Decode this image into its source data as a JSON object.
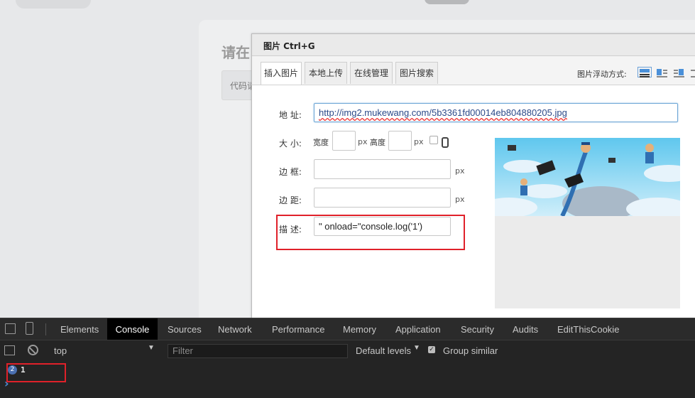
{
  "background": {
    "heading": "请在",
    "editor_text": "代码请"
  },
  "dialog": {
    "title": "图片 Ctrl+G",
    "tabs": [
      "插入图片",
      "本地上传",
      "在线管理",
      "图片搜索"
    ],
    "float_label": "图片浮动方式:",
    "float_icons": [
      "float-none-icon",
      "float-left-icon",
      "float-right-icon",
      "float-center-icon"
    ],
    "fields": {
      "address_label": "地 址:",
      "address_value": "http://img2.mukewang.com/5b3361fd00014eb804880205.jpg",
      "size_label": "大 小:",
      "width_label": "宽度",
      "height_label": "高度",
      "px_unit": "px",
      "border_label": "边 框:",
      "margin_label": "边 距:",
      "desc_label": "描 述:",
      "desc_value": "\" onload=\"console.log('1')"
    },
    "preview_image": "cloud-computing-illustration"
  },
  "devtools": {
    "tabs": [
      "Elements",
      "Console",
      "Sources",
      "Network",
      "Performance",
      "Memory",
      "Application",
      "Security",
      "Audits",
      "EditThisCookie"
    ],
    "active_tab": "Console",
    "context": "top",
    "filter_placeholder": "Filter",
    "levels": "Default levels",
    "group_similar": "Group similar",
    "log_count": "2",
    "log_message": "1",
    "prompt_symbol": "›"
  },
  "colors": {
    "highlight": "#e0212a",
    "devtools_bg": "#242424",
    "accent": "#4a90d9"
  }
}
